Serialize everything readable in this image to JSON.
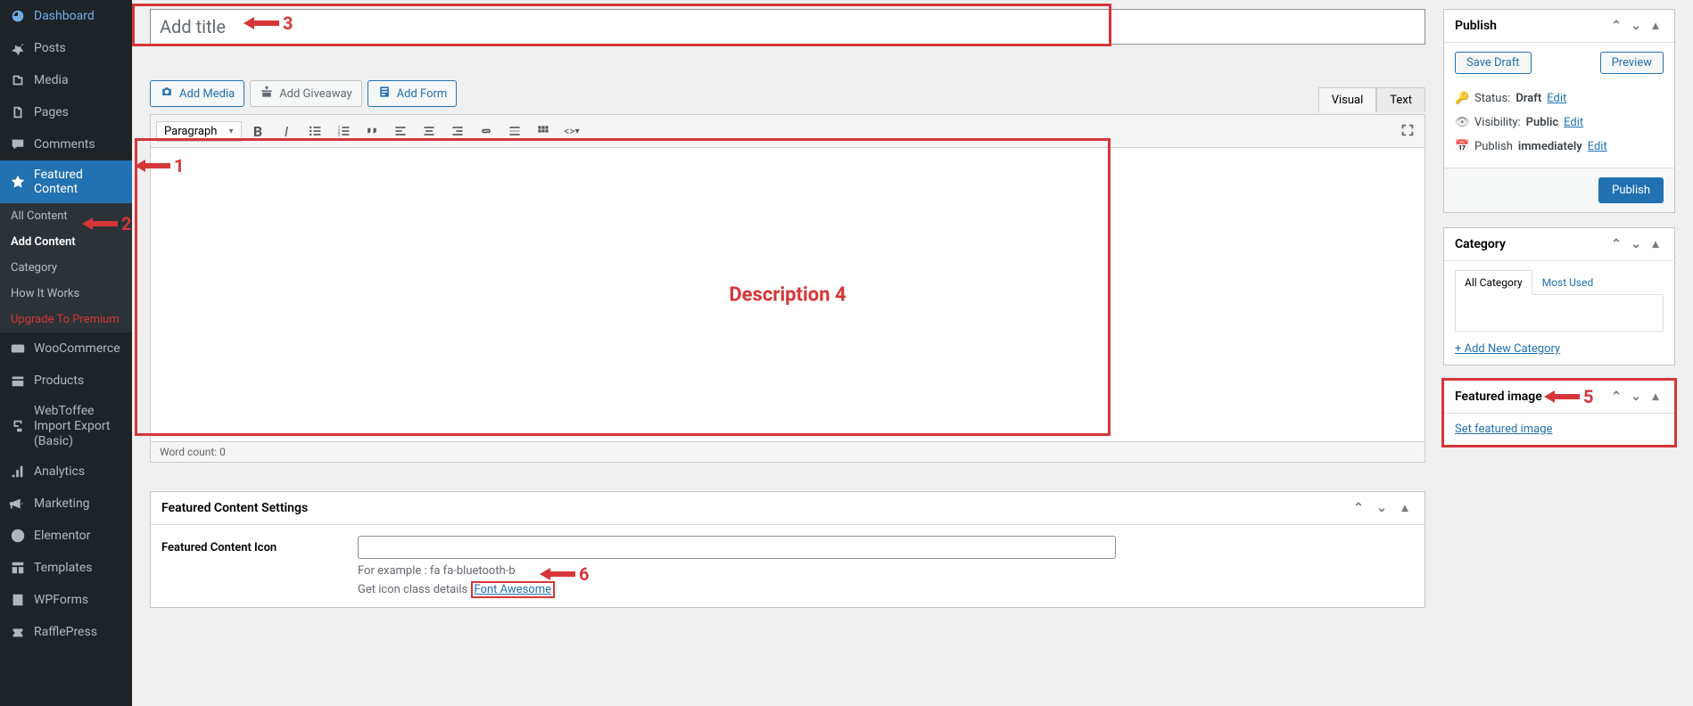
{
  "sidebar": {
    "items": [
      {
        "label": "Dashboard"
      },
      {
        "label": "Posts"
      },
      {
        "label": "Media"
      },
      {
        "label": "Pages"
      },
      {
        "label": "Comments"
      },
      {
        "label": "Featured Content"
      },
      {
        "label": "WooCommerce"
      },
      {
        "label": "Products"
      },
      {
        "label": "WebToffee Import Export (Basic)"
      },
      {
        "label": "Analytics"
      },
      {
        "label": "Marketing"
      },
      {
        "label": "Elementor"
      },
      {
        "label": "Templates"
      },
      {
        "label": "WPForms"
      },
      {
        "label": "RafflePress"
      }
    ],
    "submenu": [
      {
        "label": "All Content"
      },
      {
        "label": "Add Content"
      },
      {
        "label": "Category"
      },
      {
        "label": "How It Works"
      },
      {
        "label": "Upgrade To Premium"
      }
    ]
  },
  "title": {
    "placeholder": "Add title"
  },
  "editor": {
    "add_media": "Add Media",
    "add_giveaway": "Add Giveaway",
    "add_form": "Add Form",
    "tab_visual": "Visual",
    "tab_text": "Text",
    "format": "Paragraph",
    "word_count": "Word count: 0"
  },
  "publish": {
    "title": "Publish",
    "save_draft": "Save Draft",
    "preview": "Preview",
    "status_label": "Status:",
    "status_value": "Draft",
    "visibility_label": "Visibility:",
    "visibility_value": "Public",
    "schedule_label": "Publish",
    "schedule_value": "immediately",
    "edit": "Edit",
    "publish_btn": "Publish"
  },
  "category": {
    "title": "Category",
    "tab_all": "All Category",
    "tab_most": "Most Used",
    "add_new": "+ Add New Category"
  },
  "featured_image": {
    "title": "Featured image",
    "set_link": "Set featured image"
  },
  "settings": {
    "title": "Featured Content Settings",
    "icon_label": "Featured Content Icon",
    "example": "For example : fa fa-bluetooth-b",
    "details": "Get icon class details",
    "fa_link": "Font Awesome"
  },
  "annotations": {
    "a1": "1",
    "a2": "2",
    "a3": "3",
    "a4": "Description  4",
    "a5": "5",
    "a6": "6"
  }
}
